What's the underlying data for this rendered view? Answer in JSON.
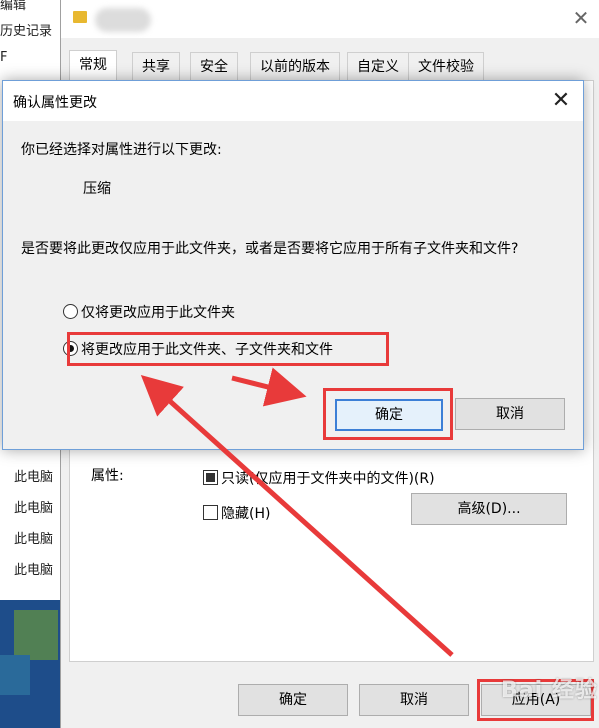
{
  "left_pane": {
    "items": [
      "编辑",
      "历史记录",
      "F",
      "此电脑",
      "此电脑",
      "此电脑",
      "此电脑"
    ]
  },
  "properties_window": {
    "tabs": [
      "常规",
      "共享",
      "安全",
      "以前的版本",
      "自定义",
      "文件校验"
    ],
    "active_tab": "常规",
    "attributes_label": "属性:",
    "readonly_label": "只读(仅应用于文件夹中的文件)(R)",
    "readonly_state": "mixed",
    "hidden_label": "隐藏(H)",
    "hidden_checked": false,
    "advanced_button": "高级(D)...",
    "ok_button": "确定",
    "cancel_button": "取消",
    "apply_button": "应用(A)"
  },
  "confirm_dialog": {
    "title": "确认属性更改",
    "intro": "你已经选择对属性进行以下更改:",
    "change": "压缩",
    "question": "是否要将此更改仅应用于此文件夹，或者是否要将它应用于所有子文件夹和文件?",
    "options": [
      {
        "label": "仅将更改应用于此文件夹",
        "selected": false
      },
      {
        "label": "将更改应用于此文件夹、子文件夹和文件",
        "selected": true
      }
    ],
    "ok_button": "确定",
    "cancel_button": "取消"
  },
  "watermark": "Bai 经验",
  "colors": {
    "highlight": "#e83a3a",
    "dialog_border": "#6f9fd8",
    "focus_button": "#3c7fd6"
  }
}
